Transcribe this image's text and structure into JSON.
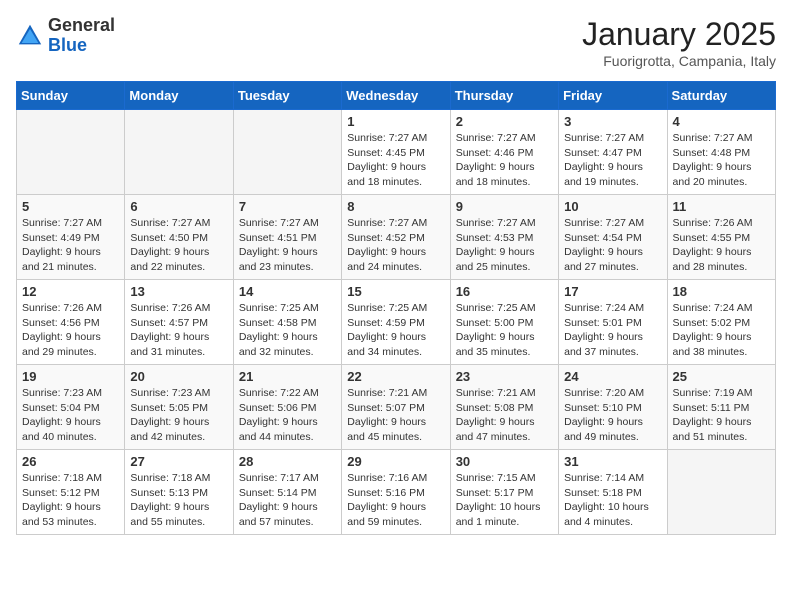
{
  "header": {
    "logo_general": "General",
    "logo_blue": "Blue",
    "month": "January 2025",
    "location": "Fuorigrotta, Campania, Italy"
  },
  "days_of_week": [
    "Sunday",
    "Monday",
    "Tuesday",
    "Wednesday",
    "Thursday",
    "Friday",
    "Saturday"
  ],
  "weeks": [
    [
      {
        "day": "",
        "empty": true
      },
      {
        "day": "",
        "empty": true
      },
      {
        "day": "",
        "empty": true
      },
      {
        "day": "1",
        "sunrise": "7:27 AM",
        "sunset": "4:45 PM",
        "daylight": "9 hours and 18 minutes."
      },
      {
        "day": "2",
        "sunrise": "7:27 AM",
        "sunset": "4:46 PM",
        "daylight": "9 hours and 18 minutes."
      },
      {
        "day": "3",
        "sunrise": "7:27 AM",
        "sunset": "4:47 PM",
        "daylight": "9 hours and 19 minutes."
      },
      {
        "day": "4",
        "sunrise": "7:27 AM",
        "sunset": "4:48 PM",
        "daylight": "9 hours and 20 minutes."
      }
    ],
    [
      {
        "day": "5",
        "sunrise": "7:27 AM",
        "sunset": "4:49 PM",
        "daylight": "9 hours and 21 minutes."
      },
      {
        "day": "6",
        "sunrise": "7:27 AM",
        "sunset": "4:50 PM",
        "daylight": "9 hours and 22 minutes."
      },
      {
        "day": "7",
        "sunrise": "7:27 AM",
        "sunset": "4:51 PM",
        "daylight": "9 hours and 23 minutes."
      },
      {
        "day": "8",
        "sunrise": "7:27 AM",
        "sunset": "4:52 PM",
        "daylight": "9 hours and 24 minutes."
      },
      {
        "day": "9",
        "sunrise": "7:27 AM",
        "sunset": "4:53 PM",
        "daylight": "9 hours and 25 minutes."
      },
      {
        "day": "10",
        "sunrise": "7:27 AM",
        "sunset": "4:54 PM",
        "daylight": "9 hours and 27 minutes."
      },
      {
        "day": "11",
        "sunrise": "7:26 AM",
        "sunset": "4:55 PM",
        "daylight": "9 hours and 28 minutes."
      }
    ],
    [
      {
        "day": "12",
        "sunrise": "7:26 AM",
        "sunset": "4:56 PM",
        "daylight": "9 hours and 29 minutes."
      },
      {
        "day": "13",
        "sunrise": "7:26 AM",
        "sunset": "4:57 PM",
        "daylight": "9 hours and 31 minutes."
      },
      {
        "day": "14",
        "sunrise": "7:25 AM",
        "sunset": "4:58 PM",
        "daylight": "9 hours and 32 minutes."
      },
      {
        "day": "15",
        "sunrise": "7:25 AM",
        "sunset": "4:59 PM",
        "daylight": "9 hours and 34 minutes."
      },
      {
        "day": "16",
        "sunrise": "7:25 AM",
        "sunset": "5:00 PM",
        "daylight": "9 hours and 35 minutes."
      },
      {
        "day": "17",
        "sunrise": "7:24 AM",
        "sunset": "5:01 PM",
        "daylight": "9 hours and 37 minutes."
      },
      {
        "day": "18",
        "sunrise": "7:24 AM",
        "sunset": "5:02 PM",
        "daylight": "9 hours and 38 minutes."
      }
    ],
    [
      {
        "day": "19",
        "sunrise": "7:23 AM",
        "sunset": "5:04 PM",
        "daylight": "9 hours and 40 minutes."
      },
      {
        "day": "20",
        "sunrise": "7:23 AM",
        "sunset": "5:05 PM",
        "daylight": "9 hours and 42 minutes."
      },
      {
        "day": "21",
        "sunrise": "7:22 AM",
        "sunset": "5:06 PM",
        "daylight": "9 hours and 44 minutes."
      },
      {
        "day": "22",
        "sunrise": "7:21 AM",
        "sunset": "5:07 PM",
        "daylight": "9 hours and 45 minutes."
      },
      {
        "day": "23",
        "sunrise": "7:21 AM",
        "sunset": "5:08 PM",
        "daylight": "9 hours and 47 minutes."
      },
      {
        "day": "24",
        "sunrise": "7:20 AM",
        "sunset": "5:10 PM",
        "daylight": "9 hours and 49 minutes."
      },
      {
        "day": "25",
        "sunrise": "7:19 AM",
        "sunset": "5:11 PM",
        "daylight": "9 hours and 51 minutes."
      }
    ],
    [
      {
        "day": "26",
        "sunrise": "7:18 AM",
        "sunset": "5:12 PM",
        "daylight": "9 hours and 53 minutes."
      },
      {
        "day": "27",
        "sunrise": "7:18 AM",
        "sunset": "5:13 PM",
        "daylight": "9 hours and 55 minutes."
      },
      {
        "day": "28",
        "sunrise": "7:17 AM",
        "sunset": "5:14 PM",
        "daylight": "9 hours and 57 minutes."
      },
      {
        "day": "29",
        "sunrise": "7:16 AM",
        "sunset": "5:16 PM",
        "daylight": "9 hours and 59 minutes."
      },
      {
        "day": "30",
        "sunrise": "7:15 AM",
        "sunset": "5:17 PM",
        "daylight": "10 hours and 1 minute."
      },
      {
        "day": "31",
        "sunrise": "7:14 AM",
        "sunset": "5:18 PM",
        "daylight": "10 hours and 4 minutes."
      },
      {
        "day": "",
        "empty": true
      }
    ]
  ]
}
